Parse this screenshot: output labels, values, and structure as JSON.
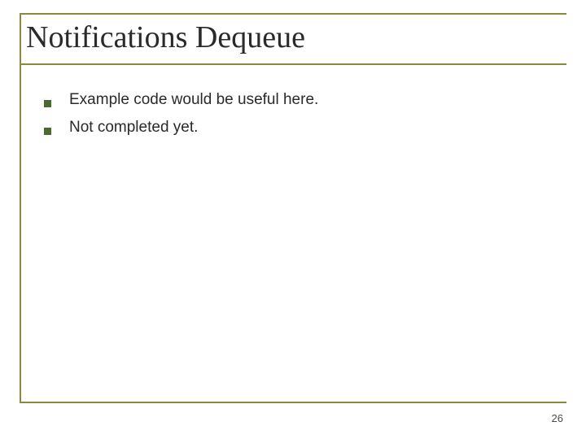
{
  "slide": {
    "title": "Notifications Dequeue",
    "bullets": [
      "Example code would be useful here.",
      "Not completed yet."
    ],
    "pageNumber": "26"
  }
}
